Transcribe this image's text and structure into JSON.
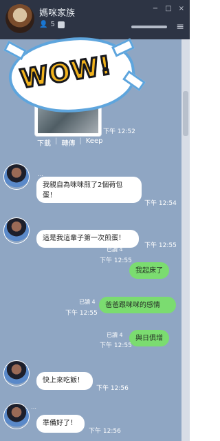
{
  "header": {
    "title": "媽咪家族",
    "member_count": "5"
  },
  "sticker": {
    "text": "WOW!"
  },
  "file_actions": [
    "下載",
    "轉傳",
    "Keep"
  ],
  "messages": [
    {
      "id": "m1",
      "time": "下午 12:52"
    },
    {
      "id": "m2",
      "text": "我親自為咪咪煎了2個荷包蛋！",
      "time": "下午 12:54"
    },
    {
      "id": "m3",
      "text": "這是我這輩子第一次煎蛋！",
      "time": "下午 12:55"
    },
    {
      "id": "m4",
      "text": "我起床了",
      "read": "已讀 4",
      "time": "下午 12:55"
    },
    {
      "id": "m5",
      "text": "爸爸跟咪咪的感情",
      "read": "已讀 4",
      "time": "下午 12:55"
    },
    {
      "id": "m6",
      "text": "與日俱增",
      "read": "已讀 4",
      "time": "下午 12:55"
    },
    {
      "id": "m7",
      "text": "快上來吃飯！",
      "time": "下午 12:56"
    },
    {
      "id": "m8",
      "text": "準備好了！",
      "time": "下午 12:56"
    }
  ],
  "colors": {
    "header": "#2d3444",
    "chat_background": "#8fa6c3",
    "outgoing_bubble": "#7bdc70",
    "accent_blue": "#5ea5dd"
  }
}
